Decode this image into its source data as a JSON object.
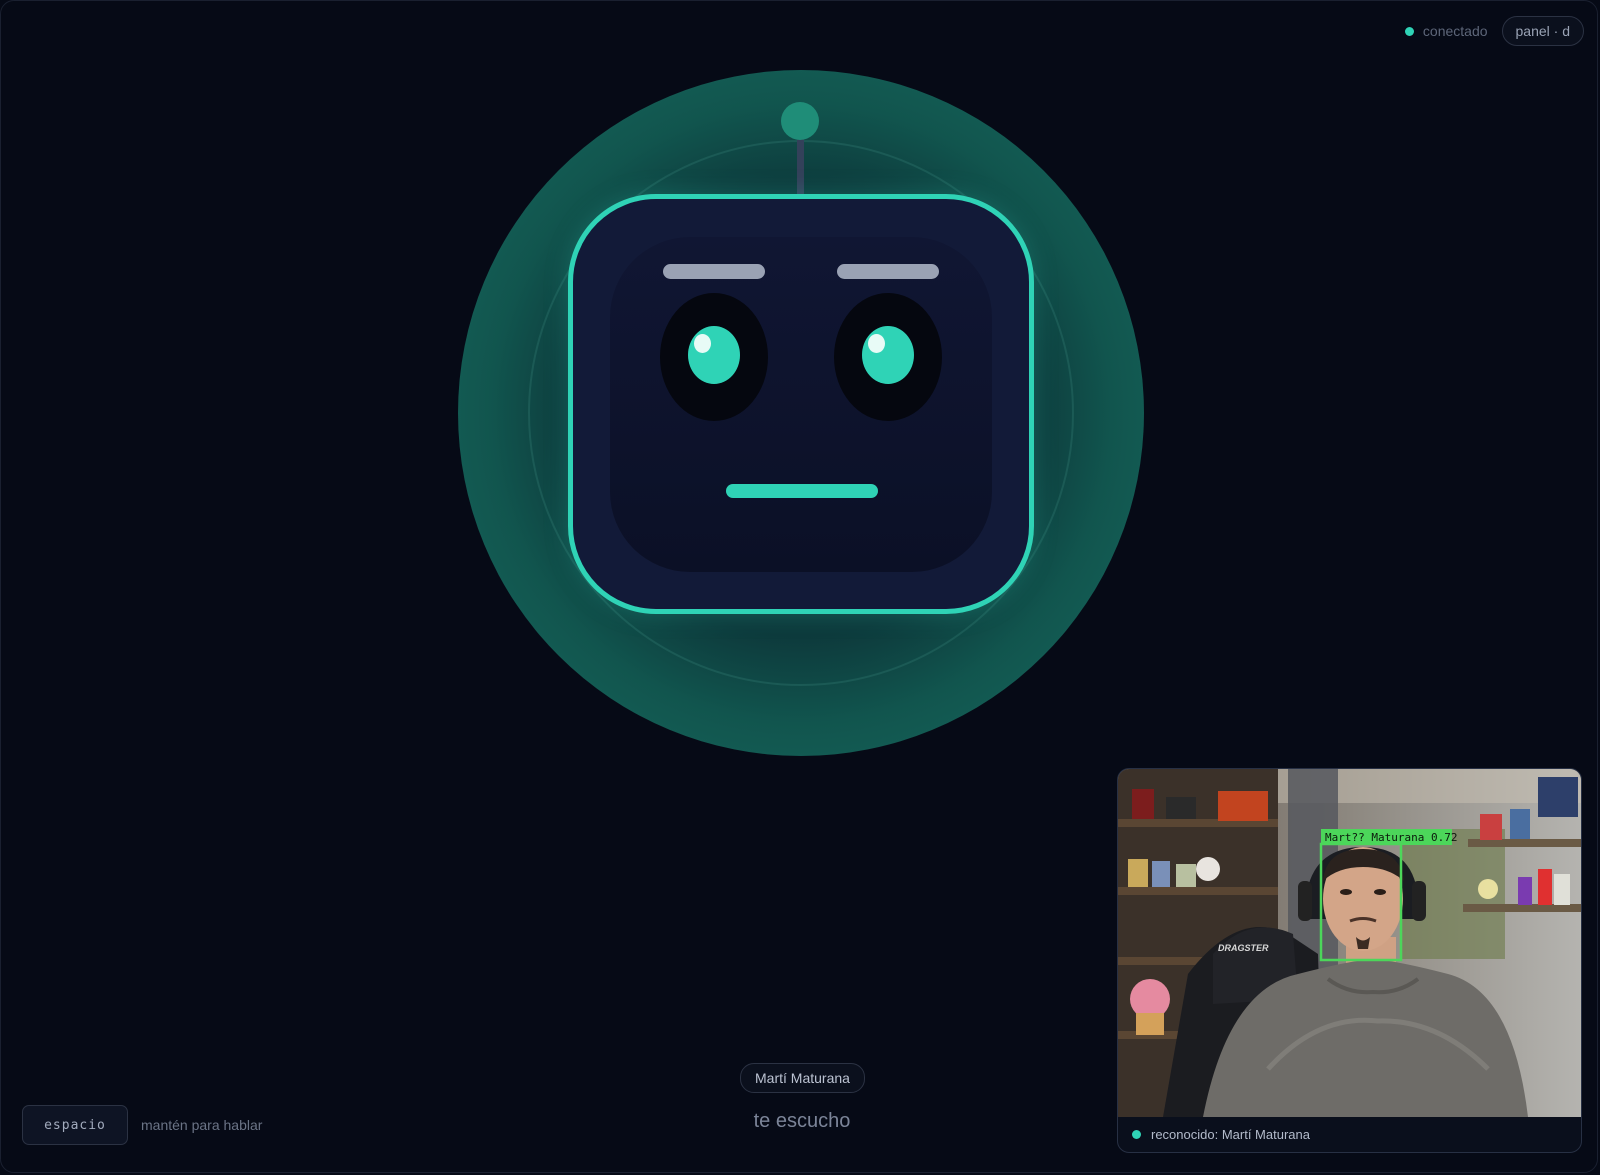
{
  "status": {
    "connection_label": "conectado",
    "panel_label": "panel · d",
    "color": "#2fd3b6"
  },
  "robot": {
    "accent_color": "#2fd3b6",
    "expression": "neutral"
  },
  "user": {
    "name": "Martí Maturana"
  },
  "listening_text": "te escucho",
  "push_to_talk": {
    "key_label": "espacio",
    "hint": "mantén para hablar"
  },
  "camera": {
    "detection_label": "Mart?? Maturana 0.72",
    "detection_color": "#4cd65a",
    "logo_text": "DRAGSTER",
    "caption": "reconocido: Martí Maturana"
  }
}
